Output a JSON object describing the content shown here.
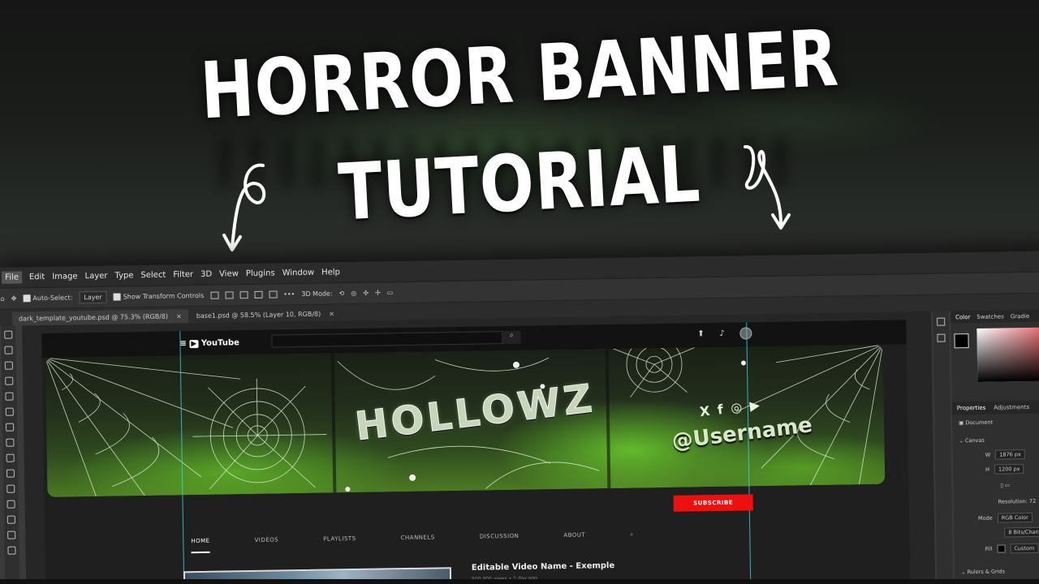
{
  "hero": {
    "line1": "HORROR BANNER",
    "line2": "TUTORIAL"
  },
  "photoshop": {
    "menu": [
      "File",
      "Edit",
      "Image",
      "Layer",
      "Type",
      "Select",
      "Filter",
      "3D",
      "View",
      "Plugins",
      "Window",
      "Help"
    ],
    "options": {
      "auto_select_label": "Auto-Select:",
      "auto_select_value": "Layer",
      "transform_label": "Show Transform Controls",
      "mode_3d_label": "3D Mode:"
    },
    "doc_tabs": [
      {
        "label": "dark_template_youtube.psd @ 75.3% (RGB/8)",
        "close": "×"
      },
      {
        "label": "base1.psd @ 58.5% (Layer 10, RGB/8)",
        "close": "×"
      }
    ],
    "panels": {
      "color_tabs": [
        "Color",
        "Swatches",
        "Gradie"
      ],
      "prop_tabs": [
        "Properties",
        "Adjustments"
      ],
      "document_label": "Document",
      "canvas_label": "Canvas",
      "w_label": "W",
      "w_value": "1876 px",
      "h_label": "H",
      "h_value": "1200 px",
      "resolution_label": "Resolution: 72",
      "mode_label": "Mode",
      "mode_value": "RGB Color",
      "bits_value": "8 Bits/Chann",
      "fill_label": "Fill",
      "fill_value": "Custom",
      "rulers_label": "Rulers & Grids"
    }
  },
  "youtube": {
    "logo": "YouTube",
    "banner_title": "HOLLOWZ",
    "banner_social": "X f ◎ ▶",
    "banner_username": "@Username",
    "subscribe": "SUBSCRIBE",
    "nav": [
      "HOME",
      "VIDEOS",
      "PLAYLISTS",
      "CHANNELS",
      "DISCUSSION",
      "ABOUT"
    ],
    "video_title": "Editable Video Name - Exemple",
    "video_meta": "500,000 views • 1 day ago"
  },
  "colors": {
    "subscribe_red": "#ee0f0f",
    "guide_cyan": "#3fd5e0",
    "banner_green": "#70d62e"
  }
}
